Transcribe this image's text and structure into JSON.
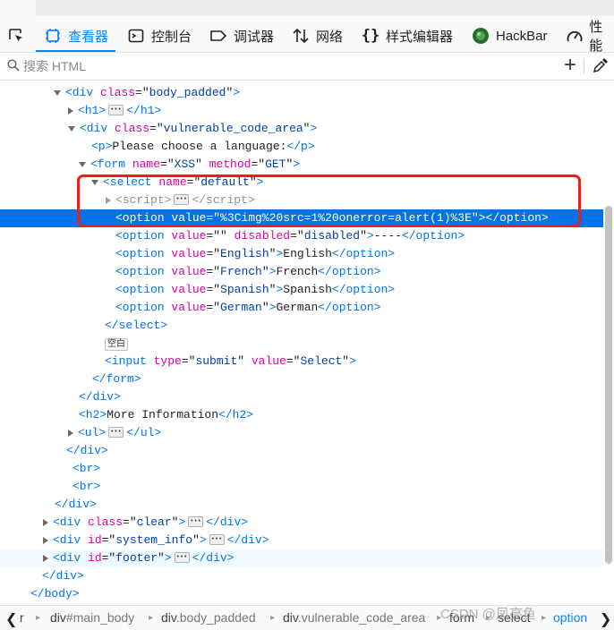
{
  "toolbar": {
    "tabs": [
      {
        "label": "查看器",
        "icon": "inspector-icon",
        "active": true
      },
      {
        "label": "控制台",
        "icon": "console-icon",
        "active": false
      },
      {
        "label": "调试器",
        "icon": "debugger-icon",
        "active": false
      },
      {
        "label": "网络",
        "icon": "network-icon",
        "active": false
      },
      {
        "label": "样式编辑器",
        "icon": "style-editor-icon",
        "active": false
      },
      {
        "label": "HackBar",
        "icon": "hackbar-icon",
        "active": false
      },
      {
        "label": "性能",
        "icon": "performance-icon",
        "active": false
      }
    ],
    "accent": "#0a84ff"
  },
  "search": {
    "placeholder": "搜索 HTML"
  },
  "tree": {
    "l1": {
      "attr1": "class",
      "val1": "body_padded"
    },
    "l2": {
      "tag": "h1"
    },
    "l3": {
      "attr1": "class",
      "val1": "vulnerable_code_area"
    },
    "l4": {
      "text": "Please choose a language:"
    },
    "l5": {
      "attr1": "name",
      "val1": "XSS",
      "attr2": "method",
      "val2": "GET"
    },
    "l6": {
      "attr1": "name",
      "val1": "default"
    },
    "l7": {
      "tag": "script"
    },
    "l8": {
      "attr1": "value",
      "val1": "%3Cimg%20src=1%20onerror=alert(1)%3E"
    },
    "l9": {
      "attr1": "value",
      "val1": "",
      "attr2": "disabled",
      "val2": "disabled",
      "text": "----"
    },
    "l10": {
      "attr1": "value",
      "val1": "English",
      "text": "English"
    },
    "l11": {
      "attr1": "value",
      "val1": "French",
      "text": "French"
    },
    "l12": {
      "attr1": "value",
      "val1": "Spanish",
      "text": "Spanish"
    },
    "l13": {
      "attr1": "value",
      "val1": "German",
      "text": "German"
    },
    "l14": {
      "badge": "空白"
    },
    "l15": {
      "attr1": "type",
      "val1": "submit",
      "attr2": "value",
      "val2": "Select"
    },
    "l16": {
      "text": "More Information"
    },
    "l17": {
      "attr1": "class",
      "val1": "clear"
    },
    "l18": {
      "attr1": "id",
      "val1": "system_info"
    },
    "l19": {
      "attr1": "id",
      "val1": "footer"
    }
  },
  "breadcrumbs": [
    {
      "tag": "r",
      "rest": ""
    },
    {
      "tag": "div",
      "rest": "#main_body"
    },
    {
      "tag": "div",
      "rest": ".body_padded"
    },
    {
      "tag": "div",
      "rest": ".vulnerable_code_area"
    },
    {
      "tag": "form",
      "rest": ""
    },
    {
      "tag": "select",
      "rest": ""
    },
    {
      "tag": "option",
      "rest": ""
    }
  ],
  "watermark": "CSDN @凤亮鱼",
  "colors": {
    "selection": "#0074e8",
    "highlight_box": "#ee1c1c"
  }
}
